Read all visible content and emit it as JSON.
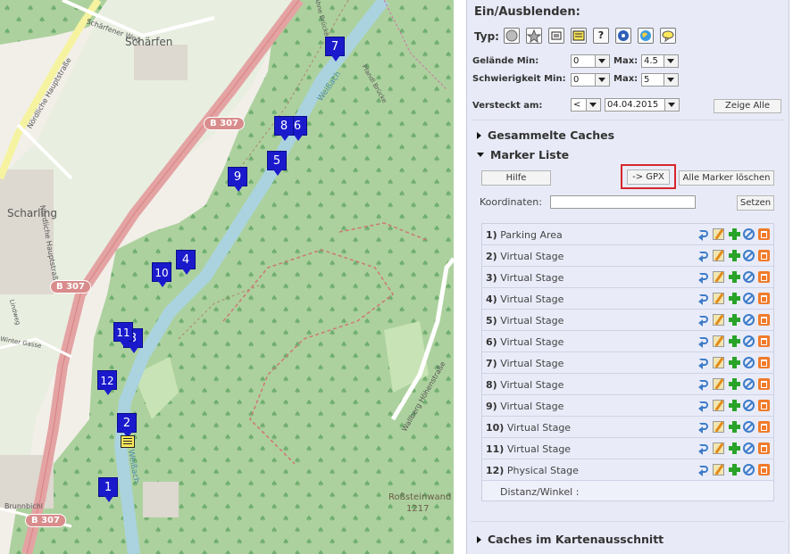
{
  "map": {
    "place_labels": {
      "schaerfen": "Schärfen",
      "scharling": "Scharling",
      "schaerfener_weg": "Schärfener Weg",
      "noerdliche_hauptstrasse_1": "Nördliche Hauptstraße",
      "noerdliche_hauptstrasse_2": "Nördliche Hauptstraße",
      "weissach_1": "Weißach",
      "weissach_2": "Weißach",
      "brunnbichl": "Brunnbichl",
      "rossteinwand": "Roßsteinwand",
      "elevation": "1217",
      "wallberg_hoehenstrasse": "Wallberg Höhenstraße",
      "pfandl_bruecke": "Pfandl Brücke",
      "ahne_bruecke": "Ahne Brücke",
      "lindweg": "Lindweg",
      "winter_gasse": "Winter Gasse"
    },
    "road_shields": [
      "B 307",
      "B 307",
      "B 307"
    ],
    "markers": [
      "1",
      "2",
      "3",
      "4",
      "5",
      "6",
      "7",
      "8",
      "9",
      "10",
      "11",
      "12"
    ]
  },
  "panel": {
    "title": "Ein/Ausblenden:",
    "typ_label": "Typ:",
    "typ_icons": [
      "traditional-cache-icon",
      "virtual-cache-icon",
      "multi-cache-icon",
      "letterbox-cache-icon",
      "mystery-cache-icon",
      "webcam-cache-icon",
      "earth-cache-icon",
      "event-cache-icon"
    ],
    "terrain": {
      "label": "Gelände Min:",
      "min": "0",
      "max_label": "Max:",
      "max": "4.5"
    },
    "difficulty": {
      "label": "Schwierigkeit Min:",
      "min": "0",
      "max_label": "Max:",
      "max": "5"
    },
    "hidden": {
      "label": "Versteckt am:",
      "op": "<",
      "date": "04.04.2015"
    },
    "show_all_button": "Zeige Alle",
    "collected_caches": "Gesammelte Caches",
    "marker_list": "Marker Liste",
    "help_button": "Hilfe",
    "gpx_button": "-> GPX",
    "delete_all_button": "Alle Marker löschen",
    "coordinates_label": "Koordinaten:",
    "coordinates_value": "",
    "set_button": "Setzen",
    "rows": [
      {
        "num": "1)",
        "name": "Parking Area"
      },
      {
        "num": "2)",
        "name": "Virtual Stage"
      },
      {
        "num": "3)",
        "name": "Virtual Stage"
      },
      {
        "num": "4)",
        "name": "Virtual Stage"
      },
      {
        "num": "5)",
        "name": "Virtual Stage"
      },
      {
        "num": "6)",
        "name": "Virtual Stage"
      },
      {
        "num": "7)",
        "name": "Virtual Stage"
      },
      {
        "num": "8)",
        "name": "Virtual Stage"
      },
      {
        "num": "9)",
        "name": "Virtual Stage"
      },
      {
        "num": "10)",
        "name": "Virtual Stage"
      },
      {
        "num": "11)",
        "name": "Virtual Stage"
      },
      {
        "num": "12)",
        "name": "Physical Stage"
      }
    ],
    "distance_label": "Distanz/Winkel :",
    "caches_in_view": "Caches im Kartenausschnitt"
  }
}
